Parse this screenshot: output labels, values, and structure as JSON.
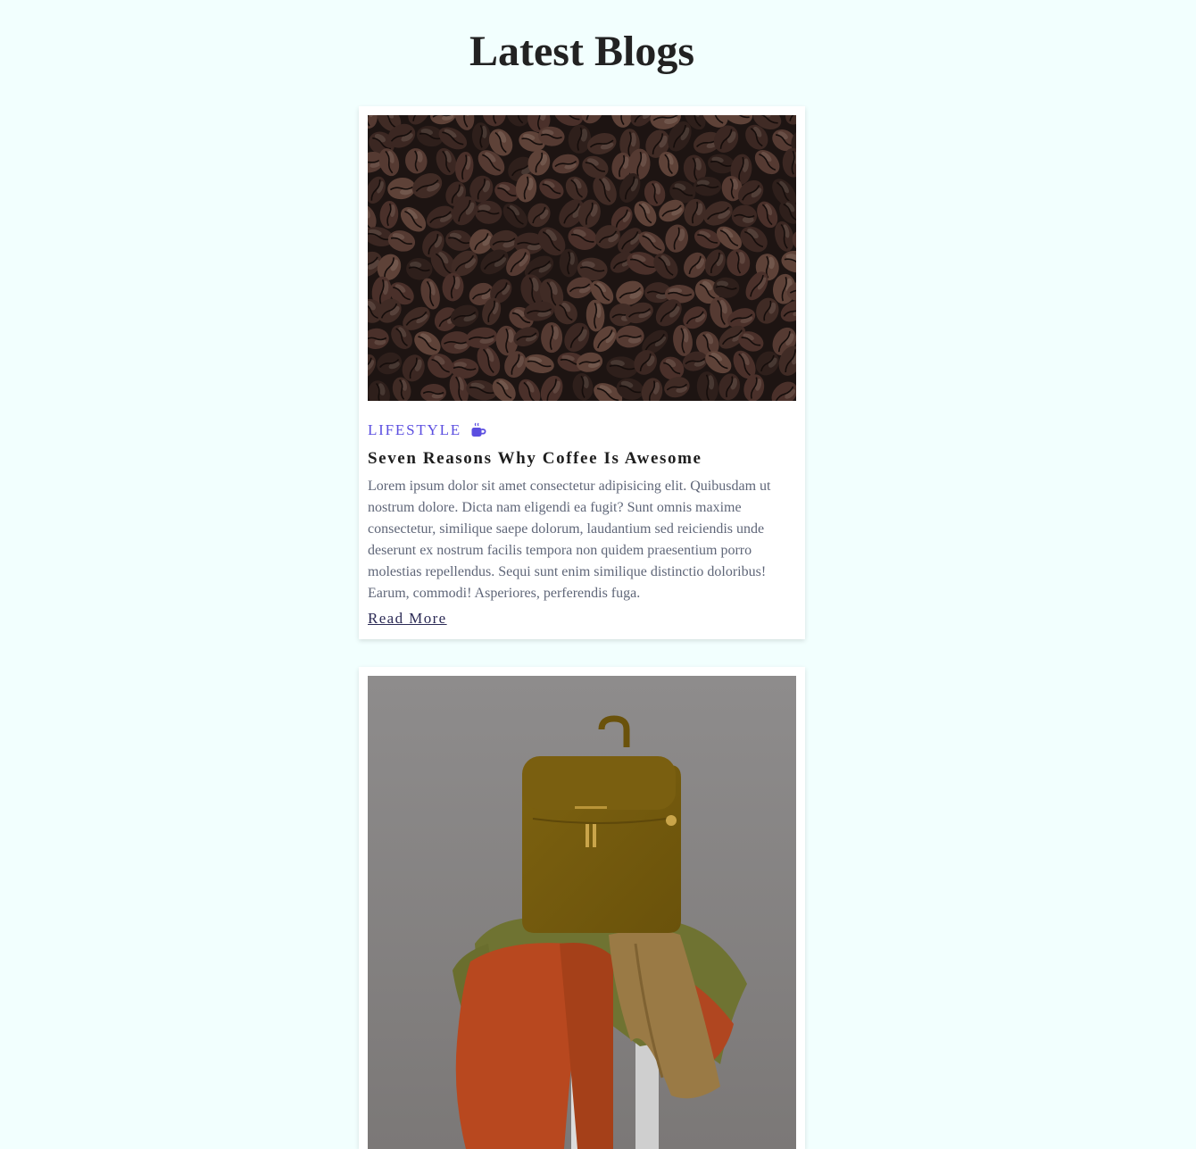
{
  "header": {
    "title": "Latest Blogs"
  },
  "posts": [
    {
      "image": "coffee-beans-photo",
      "category": "LIFESTYLE",
      "category_icon": "coffee-cup-icon",
      "title": "Seven Reasons Why Coffee Is Awesome",
      "excerpt": "Lorem ipsum dolor sit amet consectetur adipisicing elit. Quibusdam ut nostrum dolore. Dicta nam eligendi ea fugit? Sunt omnis maxime consectetur, similique saepe dolorum, laudantium sed reiciendis unde deserunt ex nostrum facilis tempora non quidem praesentium porro molestias repellendus. Sequi sunt enim similique distinctio doloribus! Earum, commodi! Asperiores, perferendis fuga.",
      "read_more": "Read More"
    },
    {
      "image": "backpack-on-stool-photo"
    }
  ],
  "colors": {
    "background": "#f2fffe",
    "accent": "#5b4ee0",
    "link": "#2b2a55"
  }
}
